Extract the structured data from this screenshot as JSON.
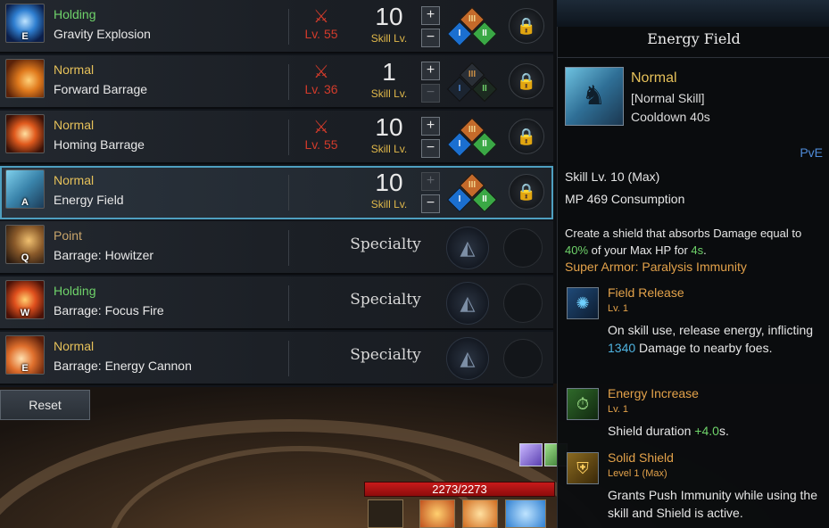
{
  "skills": [
    {
      "type": "Holding",
      "name": "Gravity Explosion",
      "key": "E",
      "req_lv": "Lv. 55",
      "level": "10",
      "level_label": "Skill Lv.",
      "plus": "+",
      "minus": "−",
      "tripods": [
        "I",
        "II",
        "III"
      ],
      "lock_icon": "lock-icon"
    },
    {
      "type": "Normal",
      "name": "Forward Barrage",
      "key": "",
      "req_lv": "Lv. 36",
      "level": "1",
      "level_label": "Skill Lv.",
      "plus": "+",
      "minus": "−",
      "tripods": [
        "I",
        "II",
        "III"
      ],
      "lock_icon": "lock-icon"
    },
    {
      "type": "Normal",
      "name": "Homing Barrage",
      "key": "",
      "req_lv": "Lv. 55",
      "level": "10",
      "level_label": "Skill Lv.",
      "plus": "+",
      "minus": "−",
      "tripods": [
        "I",
        "II",
        "III"
      ],
      "lock_icon": "lock-icon"
    },
    {
      "type": "Normal",
      "name": "Energy Field",
      "key": "A",
      "req_lv": "",
      "level": "10",
      "level_label": "Skill Lv.",
      "plus": "+",
      "minus": "−",
      "tripods": [
        "I",
        "II",
        "III"
      ],
      "lock_icon": "lock-icon"
    },
    {
      "type": "Point",
      "name": "Barrage: Howitzer",
      "key": "Q",
      "specialty": "Specialty"
    },
    {
      "type": "Holding",
      "name": "Barrage: Focus Fire",
      "key": "W",
      "specialty": "Specialty"
    },
    {
      "type": "Normal",
      "name": "Barrage: Energy Cannon",
      "key": "E",
      "specialty": "Specialty"
    }
  ],
  "reset_label": "Reset",
  "hud": {
    "hp_text": "2273/2273"
  },
  "tooltip": {
    "title": "Energy Field",
    "type": "Normal",
    "kind": "[Normal Skill]",
    "cooldown": "Cooldown 40s",
    "pve": "PvE",
    "skill_level": "Skill Lv. 10 (Max)",
    "mp": "MP 469 Consumption",
    "desc_1": "Create a shield that absorbs Damage equal to",
    "desc_pct": "40%",
    "desc_2": " of your Max HP for ",
    "desc_dur": "4s",
    "desc_3": ".",
    "super_armor": "Super Armor: Paralysis Immunity",
    "tripods": [
      {
        "name": "Field Release",
        "level": "Lv. 1",
        "desc_a": "On skill use, release energy, inflicting ",
        "desc_val": "1340",
        "desc_b": " Damage to nearby foes."
      },
      {
        "name": "Energy Increase",
        "level": "Lv. 1",
        "desc_a": "Shield duration ",
        "desc_val": "+4.0",
        "desc_b": "s."
      },
      {
        "name": "Solid Shield",
        "level": "Level 1 (Max)",
        "desc_a": "Grants Push Immunity while using the skill and Shield is active.",
        "desc_val": "",
        "desc_b": ""
      }
    ]
  },
  "colors": {
    "holding": "#6fd36a",
    "normal": "#e6c15a",
    "accent": "#4e9fc0",
    "req_red": "#d23b2b",
    "skill_lv_gold": "#e0b84a"
  }
}
